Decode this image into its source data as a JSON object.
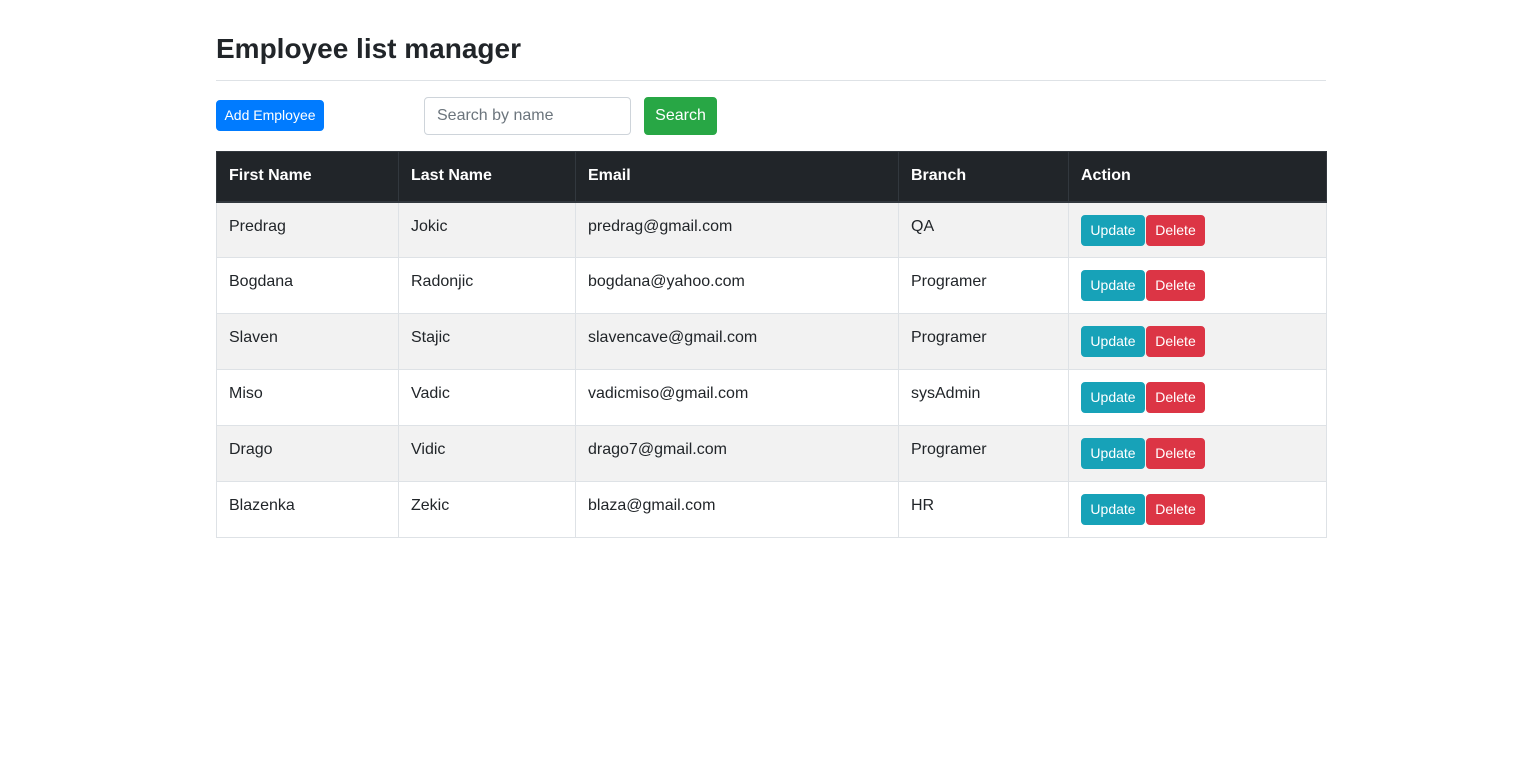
{
  "page": {
    "title": "Employee list manager"
  },
  "toolbar": {
    "add_label": "Add Employee",
    "search_placeholder": "Search by name",
    "search_value": "",
    "search_label": "Search"
  },
  "table": {
    "headers": [
      "First Name",
      "Last Name",
      "Email",
      "Branch",
      "Action"
    ],
    "rows": [
      {
        "first_name": "Predrag",
        "last_name": "Jokic",
        "email": "predrag@gmail.com",
        "branch": "QA"
      },
      {
        "first_name": "Bogdana",
        "last_name": "Radonjic",
        "email": "bogdana@yahoo.com",
        "branch": "Programer"
      },
      {
        "first_name": "Slaven",
        "last_name": "Stajic",
        "email": "slavencave@gmail.com",
        "branch": "Programer"
      },
      {
        "first_name": "Miso",
        "last_name": "Vadic",
        "email": "vadicmiso@gmail.com",
        "branch": "sysAdmin"
      },
      {
        "first_name": "Drago",
        "last_name": "Vidic",
        "email": "drago7@gmail.com",
        "branch": "Programer"
      },
      {
        "first_name": "Blazenka",
        "last_name": "Zekic",
        "email": "blaza@gmail.com",
        "branch": "HR"
      }
    ],
    "update_label": "Update",
    "delete_label": "Delete"
  },
  "colors": {
    "primary": "#007bff",
    "success": "#28a745",
    "info": "#17a2b8",
    "danger": "#dc3545",
    "header_dark": "#212529",
    "stripe": "#f2f2f2"
  }
}
